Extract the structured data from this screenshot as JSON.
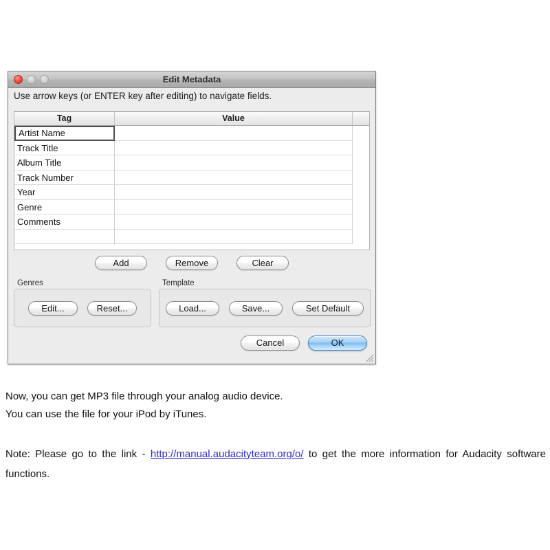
{
  "dialog": {
    "title": "Edit Metadata",
    "window_controls": [
      {
        "name": "close",
        "color": "#f2564a"
      },
      {
        "name": "minimize",
        "color": "#cfcfcf"
      },
      {
        "name": "maximize",
        "color": "#cfcfcf"
      }
    ],
    "instruction": "Use arrow keys (or ENTER key after editing) to navigate fields.",
    "table": {
      "columns": [
        "Tag",
        "Value"
      ],
      "rows": [
        {
          "tag": "Artist Name",
          "value": "",
          "focused": true
        },
        {
          "tag": "Track Title",
          "value": "",
          "focused": false
        },
        {
          "tag": "Album Title",
          "value": "",
          "focused": false
        },
        {
          "tag": "Track Number",
          "value": "",
          "focused": false
        },
        {
          "tag": "Year",
          "value": "",
          "focused": false
        },
        {
          "tag": "Genre",
          "value": "",
          "focused": false
        },
        {
          "tag": "Comments",
          "value": "",
          "focused": false
        },
        {
          "tag": "",
          "value": "",
          "focused": false
        }
      ]
    },
    "row_actions": {
      "add": "Add",
      "remove": "Remove",
      "clear": "Clear"
    },
    "genres_group": {
      "label": "Genres",
      "edit": "Edit...",
      "reset": "Reset..."
    },
    "template_group": {
      "label": "Template",
      "load": "Load...",
      "save": "Save...",
      "set_default": "Set Default"
    },
    "footer": {
      "cancel": "Cancel",
      "ok": "OK"
    },
    "accent_color": "#7fbcf0"
  },
  "page": {
    "paragraph1_line1": "Now, you can get MP3 file through your analog audio device.",
    "paragraph1_line2": "You can use the file for your iPod by iTunes.",
    "note_prefix": "Note: Please go to the link - ",
    "note_link": "http://manual.audacityteam.org/o/",
    "note_suffix": " to get the more information for Audacity software functions.",
    "link_color": "#2a2ad0"
  }
}
